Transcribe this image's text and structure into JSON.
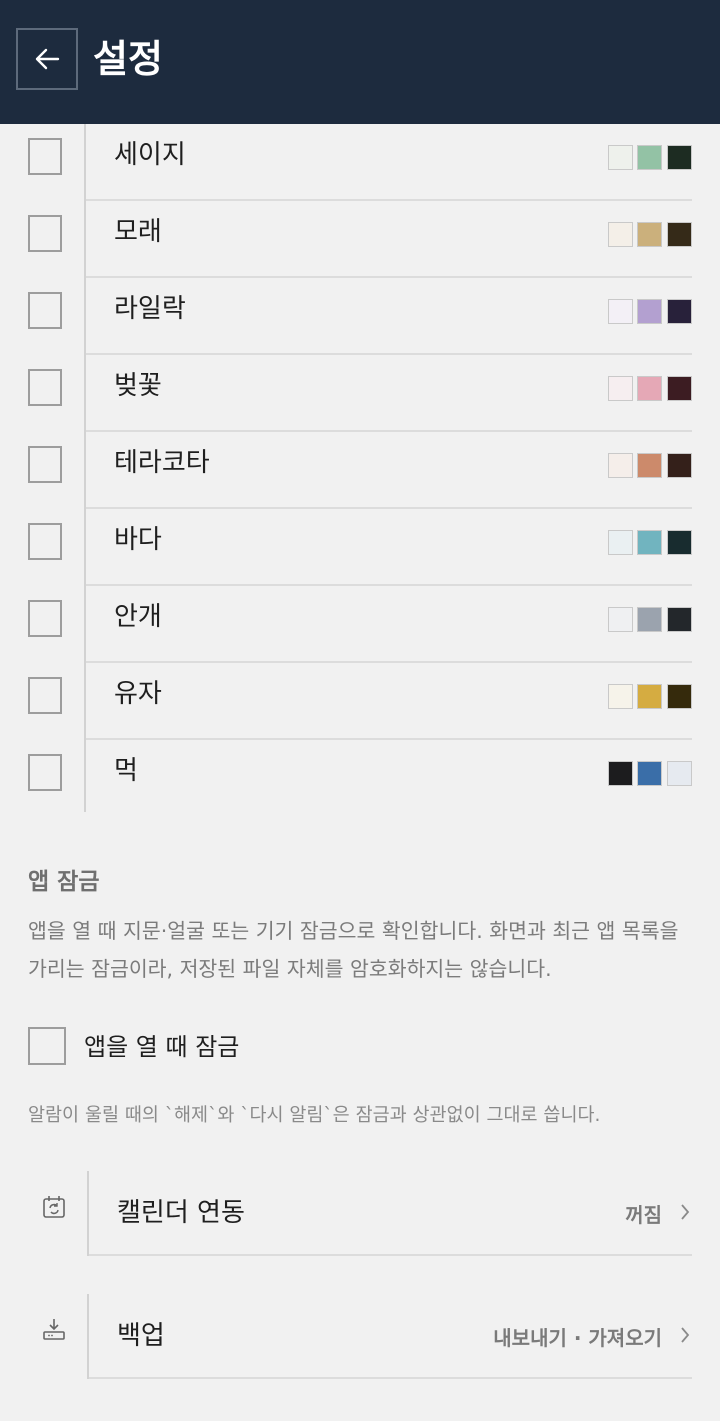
{
  "header": {
    "title": "설정",
    "back_icon": "arrow-left-icon"
  },
  "themes": [
    {
      "label": "세이지",
      "swatches": [
        "#eef1ec",
        "#93c2a5",
        "#1d2c22"
      ]
    },
    {
      "label": "모래",
      "swatches": [
        "#f4efe8",
        "#cbb07c",
        "#352a18"
      ]
    },
    {
      "label": "라일락",
      "swatches": [
        "#f3f0f6",
        "#b3a0d0",
        "#28213a"
      ]
    },
    {
      "label": "벚꽃",
      "swatches": [
        "#f6eef0",
        "#e5a8b6",
        "#3c1c22"
      ]
    },
    {
      "label": "테라코타",
      "swatches": [
        "#f5eeea",
        "#cc8a6b",
        "#34201a"
      ]
    },
    {
      "label": "바다",
      "swatches": [
        "#eaf0f2",
        "#71b4bf",
        "#182c2f"
      ]
    },
    {
      "label": "안개",
      "swatches": [
        "#eff0f2",
        "#9ba3ae",
        "#23272b"
      ]
    },
    {
      "label": "유자",
      "swatches": [
        "#f6f3ea",
        "#d5ac41",
        "#352a0c"
      ]
    },
    {
      "label": "먹",
      "swatches": [
        "#1c1c1e",
        "#3a6ea8",
        "#e6eaf0"
      ]
    }
  ],
  "app_lock": {
    "title": "앱 잠금",
    "description": "앱을 열 때 지문·얼굴 또는 기기 잠금으로 확인합니다. 화면과 최근 앱 목록을 가리는 잠금이라, 저장된 파일 자체를 암호화하지는 않습니다.",
    "checkbox_label": "앱을 열 때 잠금",
    "note": "알람이 울릴 때의 `해제`와 `다시 알림`은 잠금과 상관없이 그대로 씁니다."
  },
  "settings": [
    {
      "label": "캘린더 연동",
      "value": "꺼짐",
      "icon": "calendar-sync-icon"
    },
    {
      "label": "백업",
      "value": "내보내기 · 가져오기",
      "icon": "download-tray-icon"
    }
  ],
  "colors": {
    "header_bg": "#1d2b3e",
    "page_bg": "#f1f1f1"
  }
}
